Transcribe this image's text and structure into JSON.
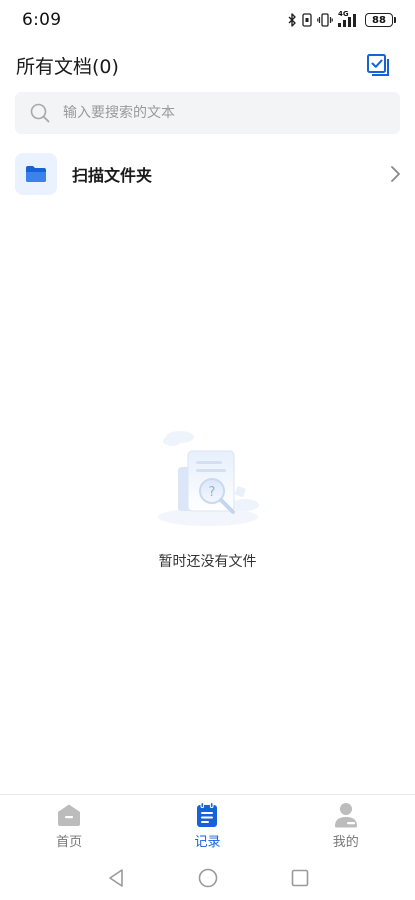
{
  "status_bar": {
    "time": "6:09",
    "network": "4G",
    "battery": "88"
  },
  "header": {
    "title": "所有文档(0)",
    "select_icon": "checkbox-multi-select-icon"
  },
  "search": {
    "placeholder": "输入要搜索的文本",
    "value": ""
  },
  "folders": [
    {
      "label": "扫描文件夹",
      "icon": "folder-icon"
    }
  ],
  "empty_state": {
    "message": "暂时还没有文件",
    "illustration": "empty-document-search-illustration"
  },
  "bottom_nav": {
    "items": [
      {
        "label": "首页",
        "icon": "home-icon",
        "active": false
      },
      {
        "label": "记录",
        "icon": "records-icon",
        "active": true
      },
      {
        "label": "我的",
        "icon": "profile-icon",
        "active": false
      }
    ]
  },
  "colors": {
    "accent": "#1762d6",
    "folder_bg": "#eaf2ff",
    "search_bg": "#f3f4f6",
    "inactive_icon": "#bcbcbc",
    "inactive_text": "#777777"
  }
}
